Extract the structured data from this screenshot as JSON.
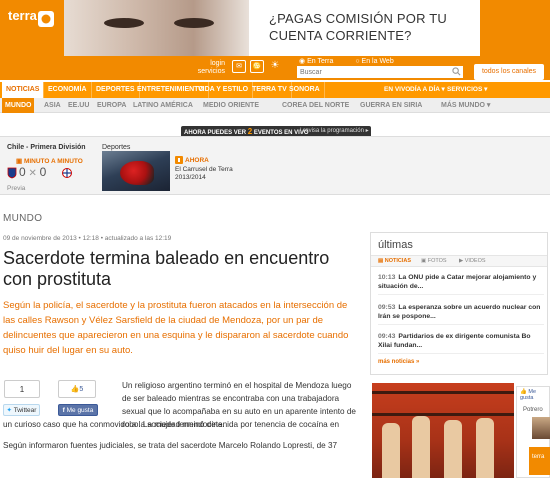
{
  "brand": {
    "name": "terra"
  },
  "ad": {
    "line1": "¿PAGAS COMISIÓN POR TU",
    "line2": "CUENTA CORRIENTE?"
  },
  "util": {
    "login": "login",
    "services": "servicios",
    "search_scope_1": "En Terra",
    "search_scope_2": "En la Web",
    "search_placeholder": "Buscar",
    "channels": "todos los canales"
  },
  "mainnav": {
    "items": [
      "NOTICIAS",
      "ECONOMÍA",
      "DEPORTES",
      "ENTRETENIMIENTO",
      "VIDA Y ESTILO",
      "TERRA TV",
      "SONORA"
    ],
    "live": "EN VIVO",
    "day": "DÍA A DÍA",
    "services": "SERVICIOS"
  },
  "subnav": {
    "items": [
      "MUNDO",
      "ASIA",
      "EE.UU",
      "EUROPA",
      "LATINO AMÉRICA",
      "MEDIO ORIENTE",
      "COREA DEL NORTE",
      "GUERRA EN SIRIA",
      "MÁS MUNDO"
    ]
  },
  "live": {
    "now_prefix": "AHORA PUEDES VER",
    "now_count": "2",
    "now_suffix": "EVENTOS EN VIVO",
    "programming": "revisa la programación"
  },
  "scoreboard": {
    "league": "Chile - Primera División",
    "minute": "MINUTO A MINUTO",
    "score_home": "0",
    "score_away": "0",
    "preview": "Previa",
    "sports_title": "Deportes",
    "now": "AHORA",
    "event_line1": "El Carrusel de Terra",
    "event_line2": "2013/2014"
  },
  "article": {
    "section": "MUNDO",
    "date": "09 de noviembre de 2013",
    "time": "12:18",
    "updated": "actualizado a las 12:19",
    "headline": "Sacerdote termina baleado en encuentro con prostituta",
    "lede": "Según la policía, el sacerdote y la prostituta fueron atacados en la intersección de las calles Rawson y Vélez Sarsfield de la ciudad de Mendoza, por un par de delincuentes que aparecieron en una esquina y le dispararon al sacerdote cuando quiso huir del lugar en su auto.",
    "share_count": "1",
    "fb_count": "5",
    "tweet": "Twittear",
    "like": "Me gusta",
    "body1": "Un religioso argentino terminó en el hospital de Mendoza luego de ser baleado mientras se encontraba con una trabajadora sexual que lo acompañaba en su auto en un aparente intento de robo. La mujer terminó detenida por tenencia de cocaína en",
    "body1b": "un curioso caso que ha conmovido a la sociedad mendocina.",
    "body2": "Según informaron fuentes judiciales, se trata del sacerdote Marcelo Rolando Lopresti, de 37"
  },
  "ultimas": {
    "title": "últimas",
    "tabs": [
      "NOTICIAS",
      "FOTOS",
      "VIDEOS"
    ],
    "items": [
      {
        "time": "10:13",
        "text": "La ONU pide a Catar mejorar alojamiento y situación de..."
      },
      {
        "time": "09:53",
        "text": "La esperanza sobre un acuerdo nuclear con Irán se pospone..."
      },
      {
        "time": "09:43",
        "text": "Partidarios de ex dirigente comunista Bo Xilai fundan..."
      }
    ],
    "more": "más noticias »"
  },
  "fbpanel": {
    "like": "Me gusta",
    "label": "Potrero"
  },
  "colors": {
    "brand": "#f28a00",
    "accent": "#e76f00",
    "nav": "#ff9900"
  }
}
